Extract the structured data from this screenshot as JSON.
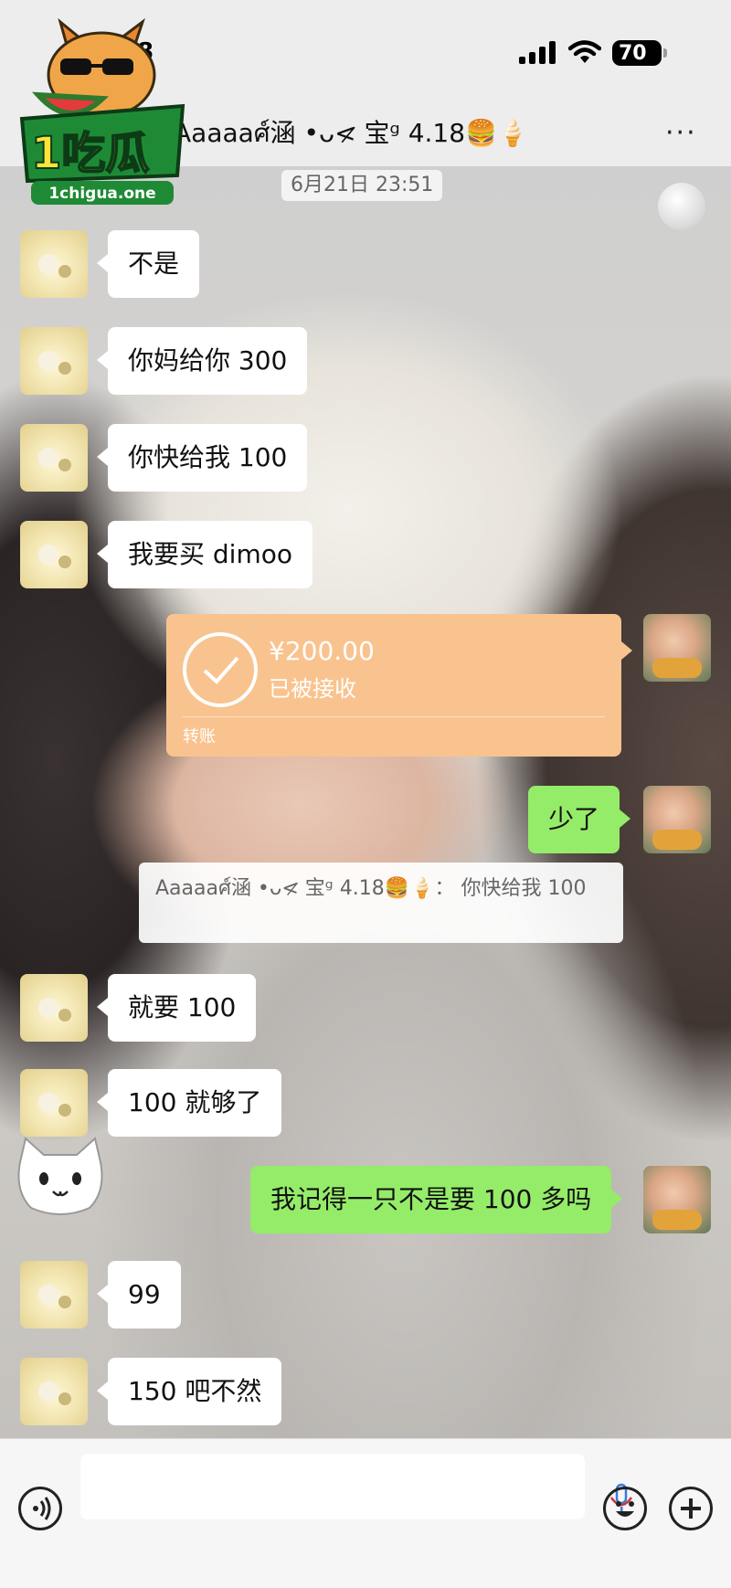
{
  "status": {
    "time_fragment": "8",
    "battery": "70"
  },
  "header": {
    "title": "Aaaaaศ์涵 •ᴗ<̷ 宝ᵍ 4.18🍔🍦",
    "more": "···"
  },
  "logo": {
    "name": "1吃瓜",
    "site": "1chigua.one"
  },
  "timestamp": "6月21日 23:51",
  "messages": {
    "m1": "不是",
    "m2": "你妈给你 300",
    "m3": "你快给我 100",
    "m4": "我要买 dimoo",
    "transfer": {
      "amount": "¥200.00",
      "state": "已被接收",
      "kind": "转账"
    },
    "m5": "少了",
    "quote": "Aaaaaศ์涵 •ᴗ<̷ 宝ᵍ 4.18🍔🍦： 你快给我 100",
    "m6": "就要 100",
    "m7": "100 就够了",
    "m8": "我记得一只不是要 100 多吗",
    "m9": "99",
    "m10": "150 吧不然"
  },
  "colors": {
    "outgoing": "#95ec69",
    "incoming": "#ffffff",
    "transfer": "#f9c38f"
  },
  "icons": [
    "signal-icon",
    "wifi-icon",
    "battery-icon",
    "more-icon",
    "check-icon",
    "voice-icon",
    "mic-icon",
    "emoji-icon",
    "plus-icon"
  ]
}
